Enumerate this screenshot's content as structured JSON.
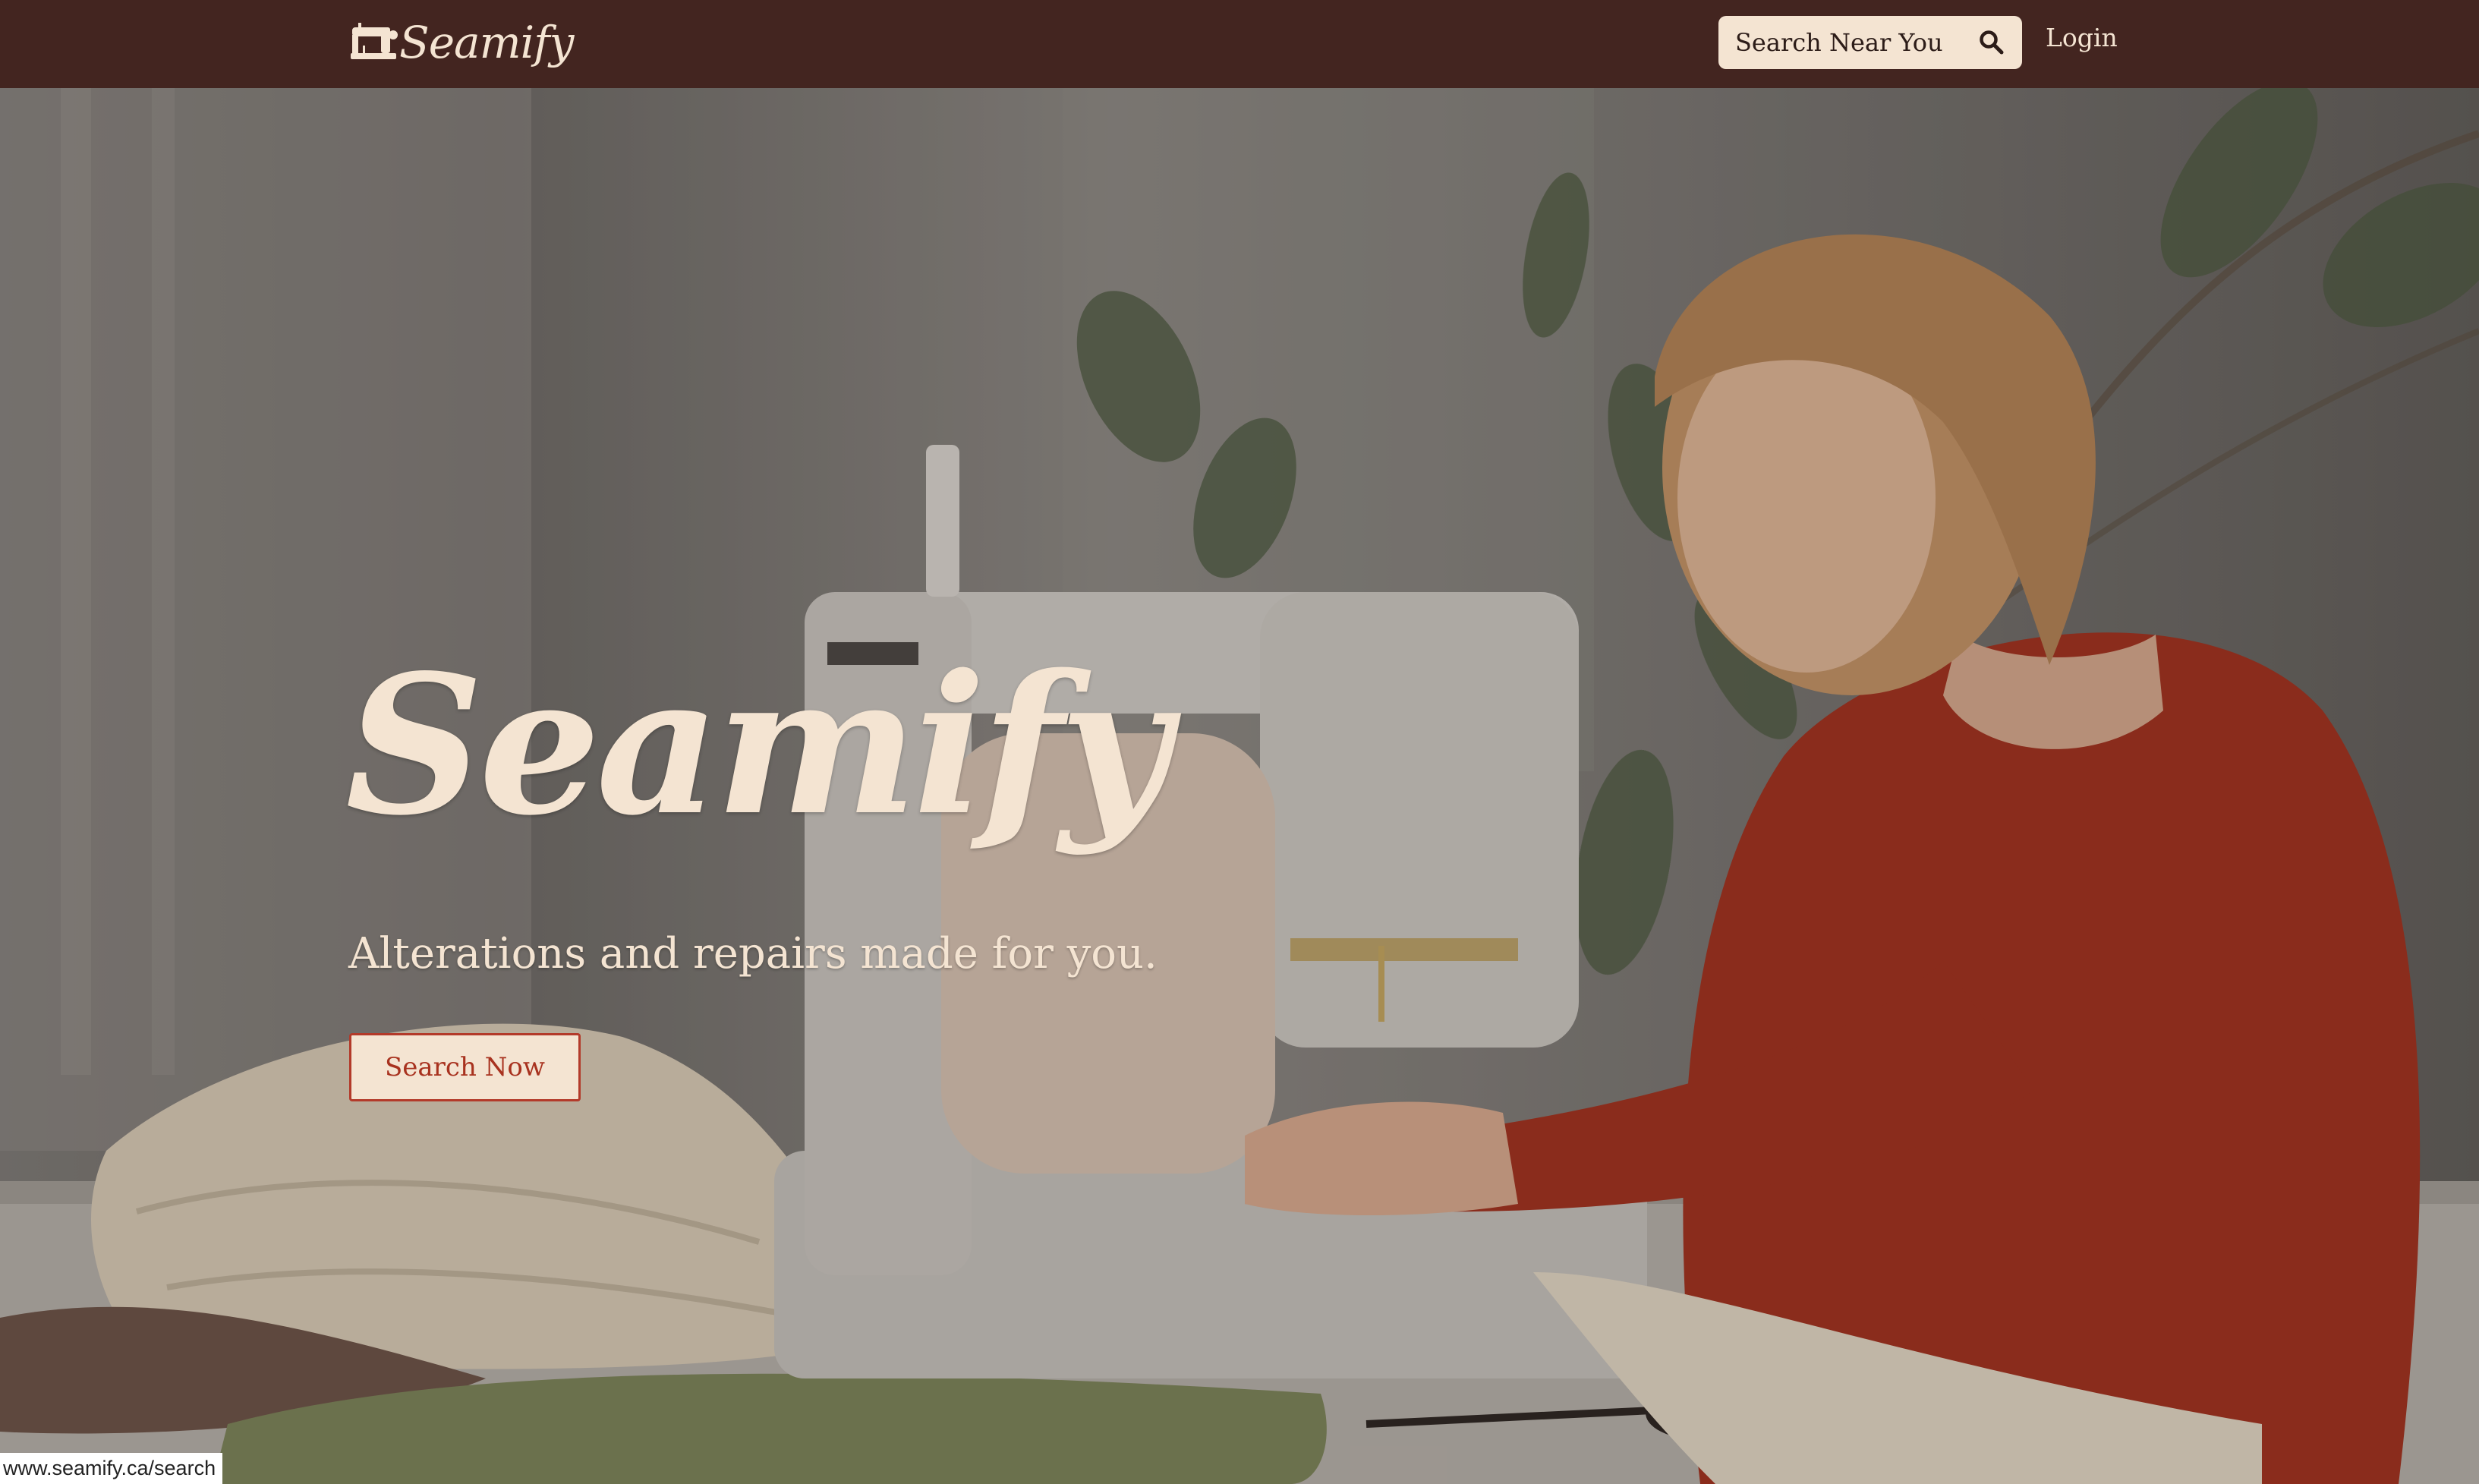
{
  "navbar": {
    "logo_text": "Seamify",
    "search_placeholder": "Search Near You",
    "login_label": "Login"
  },
  "hero": {
    "brand_title": "Seamify",
    "tagline": "Alterations and repairs made for you.",
    "cta_label": "Search Now",
    "image": "woman-at-sewing-machine-photo"
  },
  "status_bar": {
    "url": "www.seamify.ca/search"
  },
  "icons": {
    "logo": "sewing-machine-icon",
    "search": "magnifier-icon"
  },
  "colors": {
    "navbar_bg": "#432520",
    "cream": "#f4e4d2",
    "accent_red": "#b33a2a",
    "dress_red": "#a0301e"
  }
}
